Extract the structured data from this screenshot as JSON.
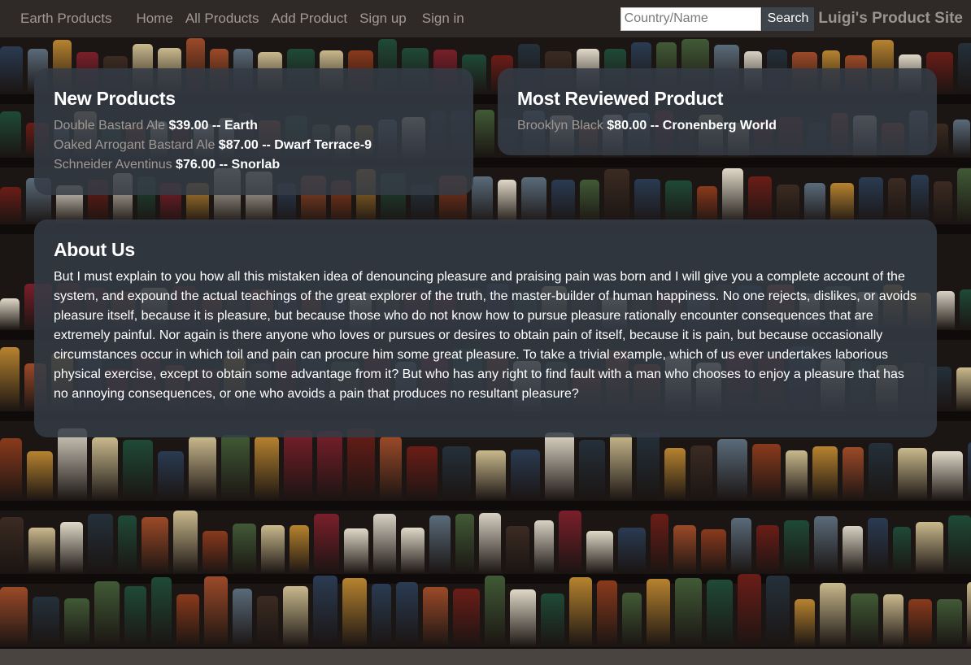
{
  "nav": {
    "brand": "Earth Products",
    "links": [
      {
        "label": "Home"
      },
      {
        "label": "All Products"
      },
      {
        "label": "Add Product"
      },
      {
        "label": "Sign up"
      },
      {
        "label": "Sign in"
      }
    ],
    "search": {
      "placeholder": "Country/Name",
      "value": "",
      "button_label": "Search"
    },
    "site_name": "Luigi's Product Site"
  },
  "new_products": {
    "title": "New Products",
    "items": [
      {
        "name": "Double Bastard Ale",
        "price": "$39.00",
        "separator": "--",
        "origin": "Earth"
      },
      {
        "name": "Oaked Arrogant Bastard Ale",
        "price": "$87.00",
        "separator": "--",
        "origin": "Dwarf Terrace-9"
      },
      {
        "name": "Schneider Aventinus",
        "price": "$76.00",
        "separator": "--",
        "origin": "Snorlab"
      }
    ]
  },
  "most_reviewed": {
    "title": "Most Reviewed Product",
    "items": [
      {
        "name": "Brooklyn Black",
        "price": "$80.00",
        "separator": "--",
        "origin": "Cronenberg World"
      }
    ]
  },
  "about": {
    "title": "About Us",
    "text": "But I must explain to you how all this mistaken idea of denouncing pleasure and praising pain was born and I will give you a complete account of the system, and expound the actual teachings of the great explorer of the truth, the master-builder of human happiness. No one rejects, dislikes, or avoids pleasure itself, because it is pleasure, but because those who do not know how to pursue pleasure rationally encounter consequences that are extremely painful. Nor again is there anyone who loves or pursues or desires to obtain pain of itself, because it is pain, but because occasionally circumstances occur in which toil and pain can procure him some great pleasure. To take a trivial example, which of us ever undertakes laborious physical exercise, except to obtain some advantage from it? But who has any right to find fault with a man who chooses to enjoy a pleasure that has no annoying consequences, or one who avoids a pain that produces no resultant pleasure?"
  },
  "colors": {
    "navbar_bg": "#2f2927",
    "nav_link": "#a19a93",
    "panel_bg": "rgba(52, 59, 70, 0.86)",
    "product_link": "#a09892",
    "search_button_bg": "#3e444b",
    "page_bg": "#4a4441"
  },
  "background_image": "beer-bottle-shelf-photo"
}
